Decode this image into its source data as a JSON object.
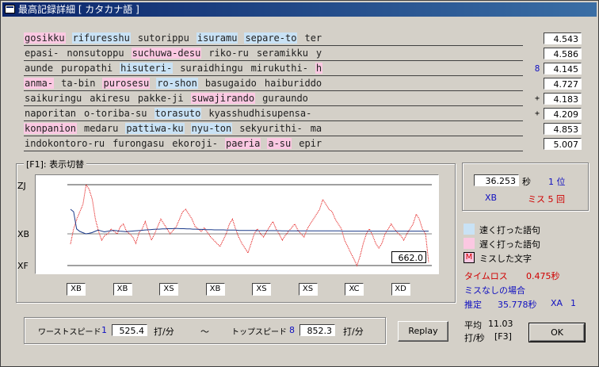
{
  "window": {
    "title": "最高記録詳細 [ カタカナ語 ]"
  },
  "rows": [
    {
      "words": [
        {
          "t": "gosikku",
          "k": "slow"
        },
        {
          "t": "rifuresshu",
          "k": "fast"
        },
        {
          "t": "sutorippu",
          "k": ""
        },
        {
          "t": "isuramu",
          "k": "fast"
        },
        {
          "t": "separe-to",
          "k": "fast"
        },
        {
          "t": "ter",
          "k": ""
        }
      ],
      "marker": "",
      "speed": "4.543"
    },
    {
      "words": [
        {
          "t": "epasi-",
          "k": ""
        },
        {
          "t": "nonsutoppu",
          "k": ""
        },
        {
          "t": "suchuwa-desu",
          "k": "slow"
        },
        {
          "t": "riko-ru",
          "k": ""
        },
        {
          "t": "seramikku",
          "k": ""
        },
        {
          "t": "y",
          "k": ""
        }
      ],
      "marker": "",
      "speed": "4.586"
    },
    {
      "words": [
        {
          "t": "aunde",
          "k": ""
        },
        {
          "t": "puropathi",
          "k": ""
        },
        {
          "t": "hisuteri-",
          "k": "fast"
        },
        {
          "t": "suraidhingu",
          "k": ""
        },
        {
          "t": "mirukuthi-",
          "k": ""
        },
        {
          "t": "h",
          "k": "slow"
        }
      ],
      "marker": "8",
      "speed": "4.145"
    },
    {
      "words": [
        {
          "t": "anma-",
          "k": "slow"
        },
        {
          "t": "ta-bin",
          "k": ""
        },
        {
          "t": "purosesu",
          "k": "slow"
        },
        {
          "t": "ro-shon",
          "k": "fast"
        },
        {
          "t": "basugaido",
          "k": ""
        },
        {
          "t": "haiburiddo",
          "k": ""
        }
      ],
      "marker": "",
      "speed": "4.727"
    },
    {
      "words": [
        {
          "t": "saikuringu",
          "k": ""
        },
        {
          "t": "akiresu",
          "k": ""
        },
        {
          "t": "pakke-ji",
          "k": ""
        },
        {
          "t": "suwajirando",
          "k": "slow"
        },
        {
          "t": "guraundo",
          "k": ""
        }
      ],
      "marker": "+",
      "speed": "4.183"
    },
    {
      "words": [
        {
          "t": "naporitan",
          "k": ""
        },
        {
          "t": "o-toriba-su",
          "k": ""
        },
        {
          "t": "torasuto",
          "k": "fast"
        },
        {
          "t": "kyasshudhisupensa-",
          "k": ""
        }
      ],
      "marker": "+",
      "speed": "4.209"
    },
    {
      "words": [
        {
          "t": "konpanion",
          "k": "slow"
        },
        {
          "t": "medaru",
          "k": ""
        },
        {
          "t": "pattiwa-ku",
          "k": "fast"
        },
        {
          "t": "nyu-ton",
          "k": "fast"
        },
        {
          "t": "sekyurithi-",
          "k": ""
        },
        {
          "t": "ma",
          "k": ""
        }
      ],
      "marker": "",
      "speed": "4.853"
    },
    {
      "words": [
        {
          "t": "indokontoro-ru",
          "k": ""
        },
        {
          "t": "furongasu",
          "k": ""
        },
        {
          "t": "ekoroji-",
          "k": ""
        },
        {
          "t": "paeria",
          "k": "slow"
        },
        {
          "t": "a-su",
          "k": "slow"
        },
        {
          "t": "epir",
          "k": ""
        }
      ],
      "marker": "",
      "speed": "5.007"
    }
  ],
  "graph": {
    "group_label": "[F1]: 表示切替",
    "y_labels": [
      "ZJ",
      "XB",
      "XF"
    ],
    "current_value": "662.0",
    "ranks": [
      "XB",
      "XB",
      "XS",
      "XB",
      "XS",
      "XS",
      "XC",
      "XD"
    ],
    "red_series": [
      468,
      520,
      560,
      590,
      620,
      700,
      680,
      640,
      560,
      510,
      480,
      495,
      500,
      520,
      510,
      500,
      530,
      540,
      510,
      500,
      490,
      470,
      505,
      520,
      550,
      510,
      480,
      500,
      530,
      560,
      540,
      520,
      500,
      515,
      530,
      560,
      590,
      600,
      580,
      560,
      530,
      520,
      510,
      525,
      505,
      490,
      480,
      470,
      460,
      480,
      500,
      540,
      560,
      520,
      490,
      470,
      455,
      440,
      470,
      500,
      520,
      500,
      490,
      510,
      530,
      550,
      520,
      500,
      480,
      495,
      510,
      525,
      540,
      515,
      500,
      490,
      520,
      540,
      560,
      580,
      600,
      640,
      620,
      600,
      590,
      560,
      540,
      520,
      480,
      460,
      440,
      420,
      400,
      430,
      470,
      500,
      520,
      495,
      470,
      455,
      470,
      500,
      520,
      540,
      520,
      505,
      495,
      480,
      500,
      520,
      540,
      580,
      560,
      520,
      500,
      410
    ],
    "blue_series": [
      600,
      590,
      520,
      510,
      505,
      500,
      502,
      505,
      510,
      515,
      512,
      508,
      510,
      512,
      514,
      513,
      511,
      510,
      509,
      510,
      511,
      512,
      513,
      514,
      515,
      516,
      517,
      518,
      519,
      519,
      520,
      520,
      521,
      521,
      522,
      522,
      521,
      521,
      520,
      520,
      519,
      519,
      518,
      518,
      517,
      517,
      517,
      516,
      516,
      516,
      516,
      515,
      515,
      515,
      515,
      514,
      514,
      514,
      514,
      514,
      514,
      513,
      513,
      513,
      513,
      513,
      513,
      513,
      513,
      512,
      512,
      512,
      512,
      512,
      512,
      512,
      512,
      512,
      512,
      512,
      512,
      512,
      512,
      512,
      512,
      512,
      512,
      512,
      512,
      511,
      511,
      511,
      511,
      511,
      511,
      511,
      511,
      511,
      511,
      511,
      511,
      511,
      511,
      511,
      511,
      511,
      511,
      511,
      511,
      511,
      511,
      511,
      511,
      511,
      511,
      511,
      511,
      511
    ]
  },
  "record": {
    "time": "36.253",
    "sec_unit": "秒",
    "rank": "1 位",
    "grade": "XB",
    "miss_label": "ミス 5 回"
  },
  "legend": [
    {
      "color": "#c9e2f5",
      "label": "速く打った語句"
    },
    {
      "color": "#fbc8e2",
      "label": "遅く打った語句"
    },
    {
      "color": "#fbc8e2",
      "label": "ミスした文字",
      "mark": "M"
    }
  ],
  "stats": {
    "time_loss_label": "タイムロス",
    "time_loss_value": "0.475秒",
    "nomiss_label": "ミスなしの場合",
    "estimate_label": "推定",
    "estimate_value": "35.778秒",
    "estimate_grade": "XA",
    "estimate_rank": "1",
    "avg_label": "平均",
    "avg_value": "11.03",
    "avg_unit": "打/秒",
    "avg_key": "[F3]"
  },
  "speeds": {
    "worst_label": "ワーストスピード",
    "worst_idx": "1",
    "worst_value": "525.4",
    "unit": "打/分",
    "tilde": "～",
    "top_label": "トップスピード",
    "top_idx": "8",
    "top_value": "852.3"
  },
  "buttons": {
    "replay": "Replay",
    "ok": "OK"
  }
}
